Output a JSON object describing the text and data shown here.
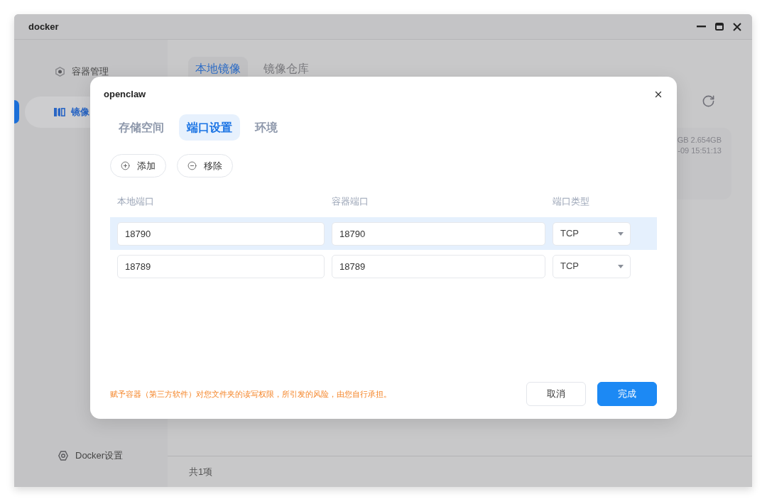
{
  "window": {
    "title": "docker"
  },
  "sidebar": {
    "items": [
      {
        "label": "容器管理",
        "kind": "container",
        "selected": false
      },
      {
        "label": "镜像",
        "kind": "image",
        "selected": true
      }
    ],
    "bottom_item": {
      "label": "Docker设置",
      "kind": "settings"
    }
  },
  "main": {
    "tabs": [
      {
        "label": "本地镜像",
        "selected": true
      },
      {
        "label": "镜像仓库",
        "selected": false
      }
    ],
    "image_card": {
      "texts": [
        "GB 2.654GB",
        "-09 15:51:13"
      ]
    },
    "status_bar": {
      "text": "共1项"
    }
  },
  "dialog": {
    "title": "openclaw",
    "tabs": [
      {
        "label": "存储空间",
        "selected": false
      },
      {
        "label": "端口设置",
        "selected": true
      },
      {
        "label": "环境",
        "selected": false
      }
    ],
    "actions": [
      {
        "label": "添加",
        "kind": "add"
      },
      {
        "label": "移除",
        "kind": "remove"
      }
    ],
    "table": {
      "columns": [
        "本地端口",
        "容器端口",
        "端口类型"
      ],
      "rows": [
        {
          "selected": true,
          "local_port": "18790",
          "container_port": "18790",
          "port_type": "TCP"
        },
        {
          "selected": false,
          "local_port": "18789",
          "container_port": "18789",
          "port_type": "TCP"
        }
      ]
    },
    "notice": "赋予容器（第三方软件）对您文件夹的读写权限，所引发的风险，由您自行承担。",
    "buttons": [
      {
        "label": "取消",
        "kind": "secondary"
      },
      {
        "label": "完成",
        "kind": "primary"
      }
    ]
  }
}
